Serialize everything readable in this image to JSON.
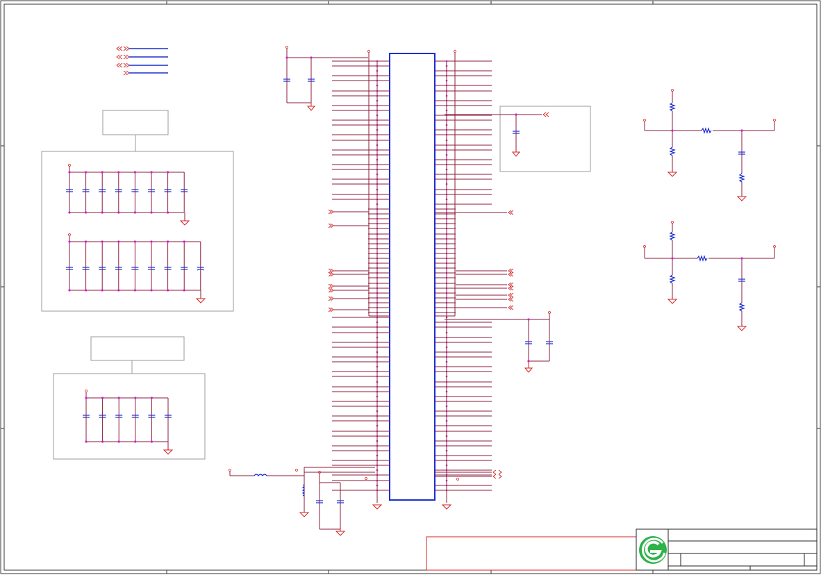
{
  "sheet": {
    "background": "#ffffff",
    "wire_color": "#8b1a3a",
    "component_color": "#1a2fd0",
    "junction_color": "#d01fd0",
    "ground_color": "#d42020"
  },
  "logo": {
    "icon": "company-logo-icon",
    "color": "#2db34a"
  }
}
